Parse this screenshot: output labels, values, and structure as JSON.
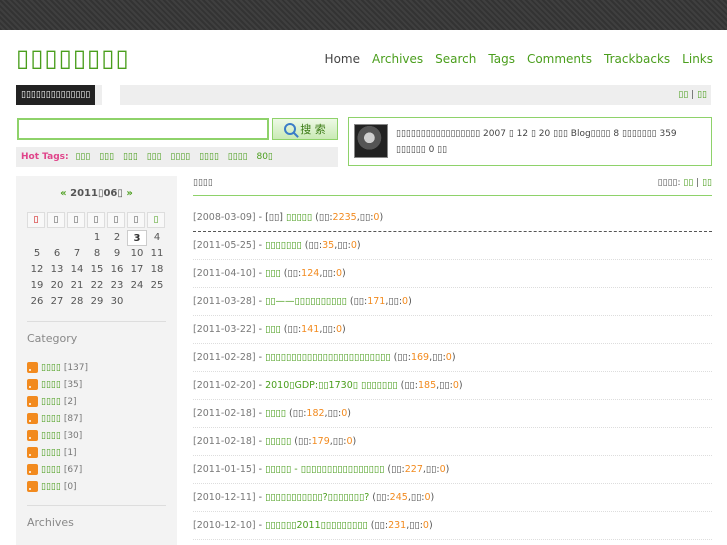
{
  "header": {
    "logo": "▯▯▯▯▯▯▯▯",
    "nav": [
      "Home",
      "Archives",
      "Search",
      "Tags",
      "Comments",
      "Trackbacks",
      "Links"
    ],
    "subtitle": "▯▯▯▯▯▯▯▯▯▯▯▯▯▯",
    "sublinks": [
      "▯▯",
      "|",
      "▯▯"
    ]
  },
  "search": {
    "value": "",
    "button_label": "搜 索"
  },
  "hottags": {
    "label": "Hot Tags:",
    "tags": [
      "▯▯▯",
      "▯▯▯",
      "▯▯▯",
      "▯▯▯",
      "▯▯▯▯",
      "▯▯▯▯",
      "▯▯▯▯",
      "80▯"
    ]
  },
  "about": {
    "text": "▯▯▯▯▯▯▯▯▯▯▯▯▯▯▯▯▯ 2007 ▯ 12 ▯ 20 ▯▯▯ Blog▯▯▯▯ 8 ▯▯▯▯▯▯▯ 359 ▯▯▯▯▯▯ 0 ▯▯"
  },
  "calendar": {
    "prev": "«",
    "title": "2011▯06▯",
    "next": "»",
    "weekdays": [
      "▯",
      "▯",
      "▯",
      "▯",
      "▯",
      "▯",
      "▯"
    ],
    "weeks": [
      [
        "",
        "",
        "",
        "1",
        "2",
        "3",
        "4"
      ],
      [
        "5",
        "6",
        "7",
        "8",
        "9",
        "10",
        "11"
      ],
      [
        "12",
        "13",
        "14",
        "15",
        "16",
        "17",
        "18"
      ],
      [
        "19",
        "20",
        "21",
        "22",
        "23",
        "24",
        "25"
      ],
      [
        "26",
        "27",
        "28",
        "29",
        "30",
        "",
        ""
      ]
    ],
    "today": "3"
  },
  "category": {
    "title": "Category",
    "items": [
      {
        "name": "▯▯▯▯",
        "count": "[137]"
      },
      {
        "name": "▯▯▯▯",
        "count": "[35]"
      },
      {
        "name": "▯▯▯▯",
        "count": "[2]"
      },
      {
        "name": "▯▯▯▯",
        "count": "[87]"
      },
      {
        "name": "▯▯▯▯",
        "count": "[30]"
      },
      {
        "name": "▯▯▯▯",
        "count": "[1]"
      },
      {
        "name": "▯▯▯▯",
        "count": "[67]"
      },
      {
        "name": "▯▯▯▯",
        "count": "[0]"
      }
    ]
  },
  "archives": {
    "title": "Archives"
  },
  "main": {
    "heading": "▯▯▯▯",
    "sort_label": "▯▯▯▯:",
    "sort_options": [
      "▯▯",
      "|",
      "▯▯"
    ],
    "posts": [
      {
        "date": "[2008-03-09]",
        "prefix": "[▯▯]",
        "title": "▯▯▯▯▯",
        "views_label": "▯▯:",
        "views": "2235",
        "comments_label": "▯▯:",
        "comments": "0"
      },
      {
        "date": "[2011-05-25]",
        "prefix": "",
        "title": "▯▯▯▯▯▯▯",
        "views_label": "▯▯:",
        "views": "35",
        "comments_label": "▯▯:",
        "comments": "0"
      },
      {
        "date": "[2011-04-10]",
        "prefix": "",
        "title": "▯▯▯",
        "views_label": "▯▯:",
        "views": "124",
        "comments_label": "▯▯:",
        "comments": "0"
      },
      {
        "date": "[2011-03-28]",
        "prefix": "",
        "title": "▯▯——▯▯▯▯▯▯▯▯▯▯",
        "views_label": "▯▯:",
        "views": "171",
        "comments_label": "▯▯:",
        "comments": "0"
      },
      {
        "date": "[2011-03-22]",
        "prefix": "",
        "title": "▯▯▯",
        "views_label": "▯▯:",
        "views": "141",
        "comments_label": "▯▯:",
        "comments": "0"
      },
      {
        "date": "[2011-02-28]",
        "prefix": "",
        "title": "▯▯▯▯▯▯▯▯▯▯▯▯▯▯▯▯▯▯▯▯▯▯▯▯",
        "views_label": "▯▯:",
        "views": "169",
        "comments_label": "▯▯:",
        "comments": "0"
      },
      {
        "date": "[2011-02-20]",
        "prefix": "",
        "title": "2010▯GDP:▯▯1730▯ ▯▯▯▯▯▯▯",
        "views_label": "▯▯:",
        "views": "185",
        "comments_label": "▯▯:",
        "comments": "0"
      },
      {
        "date": "[2011-02-18]",
        "prefix": "",
        "title": "▯▯▯▯",
        "views_label": "▯▯:",
        "views": "182",
        "comments_label": "▯▯:",
        "comments": "0"
      },
      {
        "date": "[2011-02-18]",
        "prefix": "",
        "title": "▯▯▯▯▯",
        "views_label": "▯▯:",
        "views": "179",
        "comments_label": "▯▯:",
        "comments": "0"
      },
      {
        "date": "[2011-01-15]",
        "prefix": "",
        "title": "▯▯▯▯▯ - ▯▯▯▯▯▯▯▯▯▯▯▯▯▯▯▯",
        "views_label": "▯▯:",
        "views": "227",
        "comments_label": "▯▯:",
        "comments": "0"
      },
      {
        "date": "[2010-12-11]",
        "prefix": "",
        "title": "▯▯▯▯▯▯▯▯▯▯▯?▯▯▯▯▯▯▯?",
        "views_label": "▯▯:",
        "views": "245",
        "comments_label": "▯▯:",
        "comments": "0"
      },
      {
        "date": "[2010-12-10]",
        "prefix": "",
        "title": "▯▯▯▯▯▯2011▯▯▯▯▯▯▯▯▯",
        "views_label": "▯▯:",
        "views": "231",
        "comments_label": "▯▯:",
        "comments": "0"
      }
    ]
  },
  "colors": {
    "accent": "#4a9e1c",
    "highlight": "#f28a1e",
    "hot": "#e0448a"
  },
  "icons": [
    "search-icon",
    "rss-icon",
    "avatar"
  ]
}
